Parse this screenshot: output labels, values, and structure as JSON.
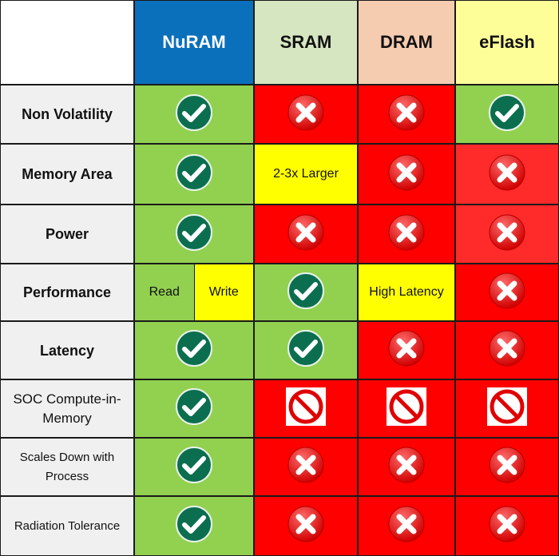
{
  "colors": {
    "green": "#92d050",
    "red": "#ff0000",
    "red_light": "#ff2a2a",
    "yellow": "#ffff00",
    "label_bg": "#f0f0f0",
    "check_icon": "#0b6e4f"
  },
  "header": {
    "corner": "",
    "columns": [
      {
        "label": "NuRAM",
        "bg": "#0b70bb",
        "color": "#ffffff"
      },
      {
        "label": "SRAM",
        "bg": "#d6e6c0",
        "color": "#111111"
      },
      {
        "label": "DRAM",
        "bg": "#f6ccb0",
        "color": "#111111"
      },
      {
        "label": "eFlash",
        "bg": "#fefe99",
        "color": "#111111"
      }
    ]
  },
  "rows": [
    {
      "label": "Non Volatility",
      "style": "bold",
      "cells": [
        {
          "type": "check",
          "bg": "#92d050"
        },
        {
          "type": "cross",
          "bg": "#ff0000"
        },
        {
          "type": "cross",
          "bg": "#ff0000"
        },
        {
          "type": "check",
          "bg": "#92d050"
        }
      ]
    },
    {
      "label": "Memory Area",
      "style": "bold",
      "cells": [
        {
          "type": "check",
          "bg": "#92d050"
        },
        {
          "type": "text",
          "text": "2-3x Larger",
          "bg": "#ffff00"
        },
        {
          "type": "cross",
          "bg": "#ff0000"
        },
        {
          "type": "cross",
          "bg": "#ff2a2a"
        }
      ]
    },
    {
      "label": "Power",
      "style": "bold",
      "cells": [
        {
          "type": "check",
          "bg": "#92d050"
        },
        {
          "type": "cross",
          "bg": "#ff0000"
        },
        {
          "type": "cross",
          "bg": "#ff0000"
        },
        {
          "type": "cross",
          "bg": "#ff2a2a"
        }
      ]
    },
    {
      "label": "Performance",
      "style": "bold",
      "cells": [
        {
          "type": "split",
          "parts": [
            {
              "text": "Read",
              "bg": "#92d050"
            },
            {
              "text": "Write",
              "bg": "#ffff00"
            }
          ]
        },
        {
          "type": "check",
          "bg": "#92d050"
        },
        {
          "type": "text",
          "text": "High Latency",
          "bg": "#ffff00"
        },
        {
          "type": "cross",
          "bg": "#ff0000"
        }
      ]
    },
    {
      "label": "Latency",
      "style": "bold",
      "cells": [
        {
          "type": "check",
          "bg": "#92d050"
        },
        {
          "type": "check",
          "bg": "#92d050"
        },
        {
          "type": "cross",
          "bg": "#ff0000"
        },
        {
          "type": "cross",
          "bg": "#ff0000"
        }
      ]
    },
    {
      "label": "SOC Compute-in-Memory",
      "style": "normal",
      "cells": [
        {
          "type": "check",
          "bg": "#92d050"
        },
        {
          "type": "prohibited",
          "bg": "#ff0000"
        },
        {
          "type": "prohibited",
          "bg": "#ff0000"
        },
        {
          "type": "prohibited",
          "bg": "#ff0000"
        }
      ]
    },
    {
      "label": "Scales Down with Process",
      "style": "small",
      "cells": [
        {
          "type": "check",
          "bg": "#92d050"
        },
        {
          "type": "cross",
          "bg": "#ff0000"
        },
        {
          "type": "cross",
          "bg": "#ff0000"
        },
        {
          "type": "cross",
          "bg": "#ff0000"
        }
      ]
    },
    {
      "label": "Radiation Tolerance",
      "style": "small",
      "cells": [
        {
          "type": "check",
          "bg": "#92d050"
        },
        {
          "type": "cross",
          "bg": "#ff0000"
        },
        {
          "type": "cross",
          "bg": "#ff0000"
        },
        {
          "type": "cross",
          "bg": "#ff0000"
        }
      ]
    }
  ]
}
